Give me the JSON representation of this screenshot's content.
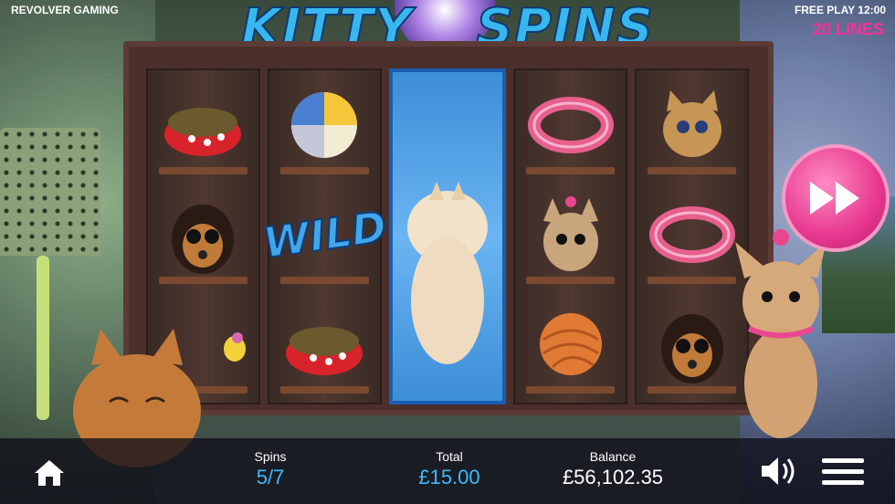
{
  "brand": "REVOLVER GAMING",
  "mode_time": "FREE PLAY  12:00",
  "lines": "20 LINES",
  "title": {
    "left": "KITTY",
    "right": "SPINS"
  },
  "wild_label": "WILD",
  "footer": {
    "spins_label": "Spins",
    "spins_value": "5/7",
    "total_label": "Total",
    "total_value": "£15.00",
    "balance_label": "Balance",
    "balance_value": "£56,102.35"
  },
  "icons": [
    "home-icon",
    "fast-forward-icon",
    "speaker-icon",
    "menu-icon"
  ],
  "colors": {
    "accent_blue": "#40b8ff",
    "accent_pink": "#e8388f",
    "title_blue": "#38b7ef"
  }
}
